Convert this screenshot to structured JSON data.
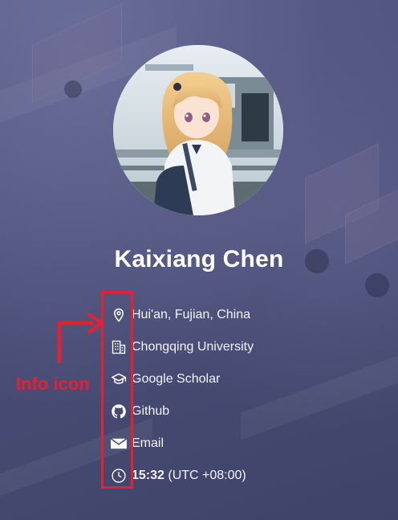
{
  "profile": {
    "name": "Kaixiang Chen"
  },
  "info": [
    {
      "icon": "location-pin-icon",
      "text": "Hui'an, Fujian, China"
    },
    {
      "icon": "building-icon",
      "text": "Chongqing University"
    },
    {
      "icon": "graduation-cap-icon",
      "text": "Google Scholar"
    },
    {
      "icon": "github-icon",
      "text": "Github"
    },
    {
      "icon": "email-icon",
      "text": "Email"
    },
    {
      "icon": "clock-icon",
      "time": "15:32",
      "tz": "(UTC +08:00)"
    }
  ],
  "annotation": {
    "label": "Info icon",
    "color": "#e8202e"
  },
  "colors": {
    "background": "#4b4f78",
    "text": "#ffffff"
  }
}
